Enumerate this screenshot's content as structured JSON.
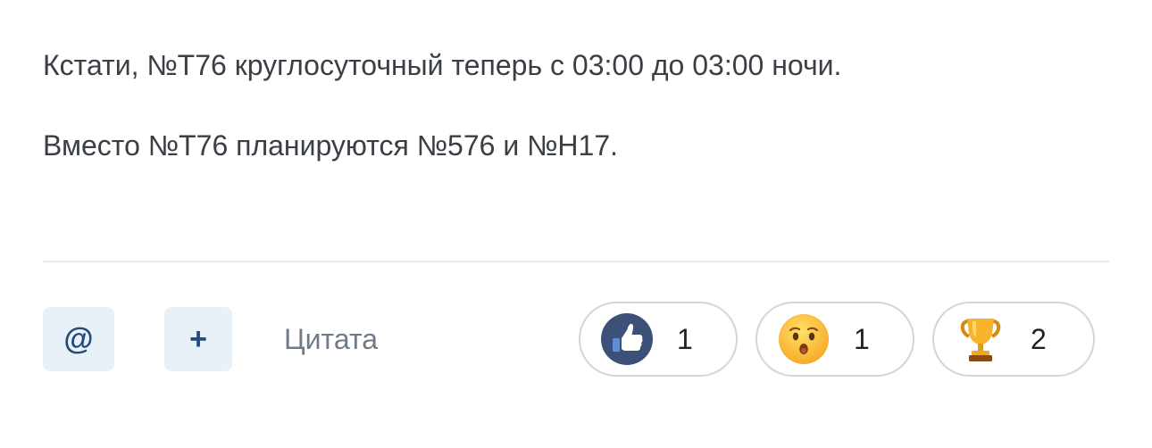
{
  "post": {
    "paragraphs": [
      "Кстати, №Т76 круглосуточный теперь с 03:00 до 03:00 ночи.",
      "Вместо №Т76 планируются №576 и №Н17."
    ]
  },
  "actions": {
    "mention_glyph": "@",
    "add_glyph": "+",
    "quote_label": "Цитата",
    "mention_icon": "at-sign-icon",
    "add_icon": "plus-icon"
  },
  "reactions": [
    {
      "icon": "thumbs-up-icon",
      "count": "1"
    },
    {
      "icon": "hushed-face-icon",
      "count": "1"
    },
    {
      "icon": "trophy-icon",
      "count": "2"
    }
  ],
  "colors": {
    "text": "#3a3f45",
    "accent_bg": "#e9f1f8",
    "accent_fg": "#224b7a",
    "muted": "#6f7b89",
    "pill_border": "#cdd6e0",
    "like_bg": "#3c5078"
  }
}
